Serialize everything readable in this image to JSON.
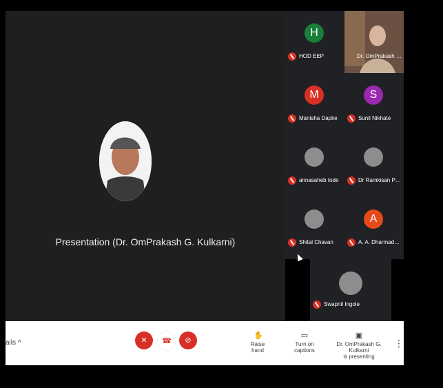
{
  "stage": {
    "caption": "Presentation (Dr. OmPrakash G. Kulkarni)"
  },
  "participants": [
    {
      "name": "HOD EEP",
      "initial": "H",
      "color": "#188038",
      "muted": true
    },
    {
      "name": "Dr. OmPrakash G. K...",
      "initial": "",
      "color": "#2e7d32",
      "muted": false
    },
    {
      "name": "Manisha Dapke",
      "initial": "M",
      "color": "#d93025",
      "muted": true
    },
    {
      "name": "Sunil Nikhate",
      "initial": "S",
      "color": "#9c27b0",
      "muted": true
    },
    {
      "name": "annasaheb tode",
      "initial": "",
      "color": "#8d8d8d",
      "muted": true
    },
    {
      "name": "Dr Ramkisan Pawar...",
      "initial": "",
      "color": "#8d8d8d",
      "muted": true
    },
    {
      "name": "Shital Chavan",
      "initial": "",
      "color": "#8d8d8d",
      "muted": true
    },
    {
      "name": "A. A. Dharmadhikari",
      "initial": "A",
      "color": "#e64a19",
      "muted": true
    },
    {
      "name": "Swapnil Ingole",
      "initial": "",
      "color": "#8d8d8d",
      "muted": true
    }
  ],
  "toolbar": {
    "details_label": "ails ^",
    "raise_hand": "Raise hand",
    "captions": "Turn on captions",
    "presenting_line1": "Dr. OmPrakash G. Kulkarni",
    "presenting_line2": "is presenting"
  }
}
